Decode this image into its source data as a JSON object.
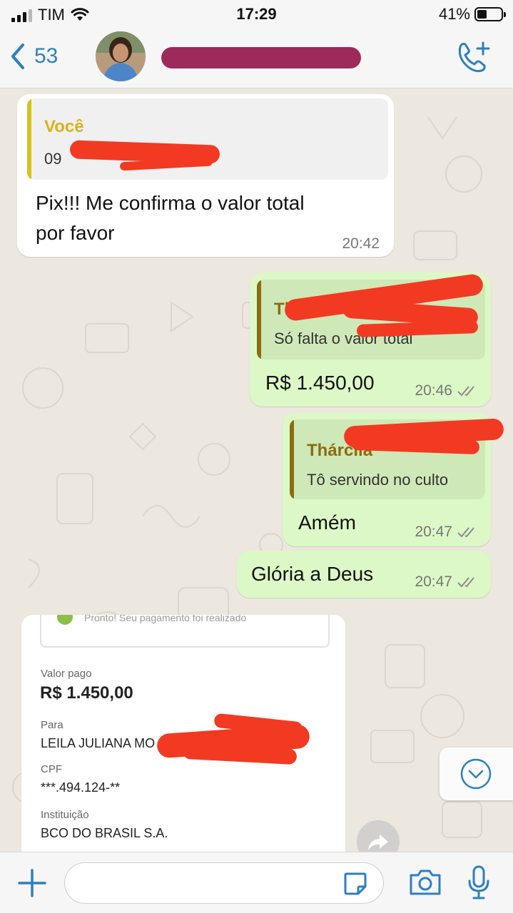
{
  "status_bar": {
    "carrier": "TIM",
    "time": "17:29",
    "battery": "41%",
    "battery_level": 0.41
  },
  "header": {
    "unread_count": "53"
  },
  "messages": [
    {
      "direction": "in",
      "quote_author": "Você",
      "quote_text": "09",
      "text_line1": "Pix!!! Me confirma o valor total",
      "text_line2": "por favor",
      "time": "20:42"
    },
    {
      "direction": "out",
      "quote_author": "Thárcil",
      "quote_text": "Só falta o valor total",
      "text": "R$ 1.450,00",
      "time": "20:46",
      "status": "read"
    },
    {
      "direction": "out",
      "quote_author": "Thárcila",
      "quote_text": "Tô servindo no culto",
      "text": "Amém",
      "time": "20:47",
      "status": "read"
    },
    {
      "direction": "out",
      "text": "Glória a Deus",
      "time": "20:47",
      "status": "read"
    }
  ],
  "receipt": {
    "top_text": "Pronto! Seu pagamento foi realizado",
    "amount_label": "Valor pago",
    "amount": "R$ 1.450,00",
    "to_label": "Para",
    "to_value": "LEILA JULIANA MO",
    "cpf_label": "CPF",
    "cpf_value": "***.494.124-**",
    "bank_label": "Instituição",
    "bank_value": "BCO DO BRASIL S.A."
  },
  "composer": {
    "placeholder": ""
  },
  "colors": {
    "accent": "#2d7fc1",
    "outgoing_bubble": "#dcf8c6",
    "incoming_bubble": "#ffffff",
    "quote_in_bar": "#d7c21b",
    "quote_out_bar": "#8a6d0f",
    "redaction": "#f23a22",
    "name_redaction": "#9e2a5c"
  },
  "icons": [
    "signal-icon",
    "wifi-icon",
    "battery-icon",
    "back-chevron-icon",
    "add-call-icon",
    "double-check-icon",
    "chevron-down-icon",
    "forward-icon",
    "plus-icon",
    "sticker-icon",
    "camera-icon",
    "microphone-icon"
  ]
}
